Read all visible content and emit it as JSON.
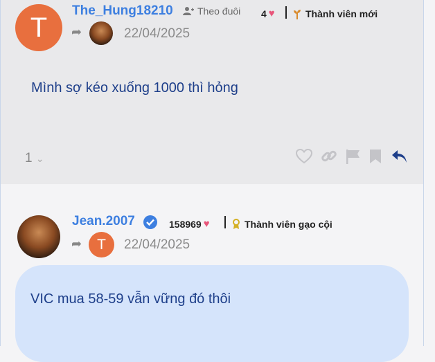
{
  "posts": [
    {
      "username": "The_Hung18210",
      "avatar_letter": "T",
      "follow_label": "Theo đuôi",
      "score": "4",
      "rank_label": "Thành viên mới",
      "date": "22/04/2025",
      "content": "Mình sợ kéo xuống 1000 thì hỏng",
      "like_count": "1"
    },
    {
      "username": "Jean.2007",
      "verified": true,
      "score": "158969",
      "rank_label": "Thành viên gạo cội",
      "reply_to_letter": "T",
      "date": "22/04/2025",
      "content": "VIC mua 58-59 vẫn vững đó thôi"
    }
  ],
  "colors": {
    "username": "#3d7fe0",
    "content": "#1e3f8a",
    "avatar_orange": "#e86f3e",
    "heart": "#e8557a",
    "bubble": "#d5e4fb"
  }
}
